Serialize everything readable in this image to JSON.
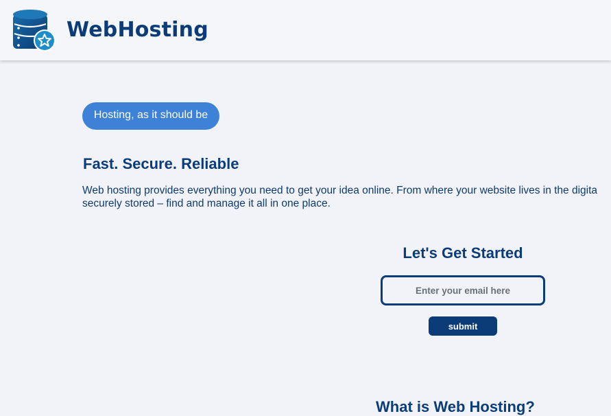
{
  "header": {
    "brand": "WebHosting",
    "logo_icon": "database-star-icon"
  },
  "hero": {
    "tagline": "Hosting, as it should be",
    "headline": "Fast. Secure. Reliable",
    "lead_line1": "Web hosting provides everything you need to get your idea online. From where your website lives in the digita",
    "lead_line2": "securely stored – find and manage it all in one place."
  },
  "signup": {
    "title": "Let's Get Started",
    "email_placeholder": "Enter your email here",
    "submit_label": "submit"
  },
  "next_section": {
    "title": "What is Web Hosting?"
  },
  "colors": {
    "brand": "#0c3c78",
    "accent": "#3d82d6",
    "background": "#f1f3f8"
  }
}
